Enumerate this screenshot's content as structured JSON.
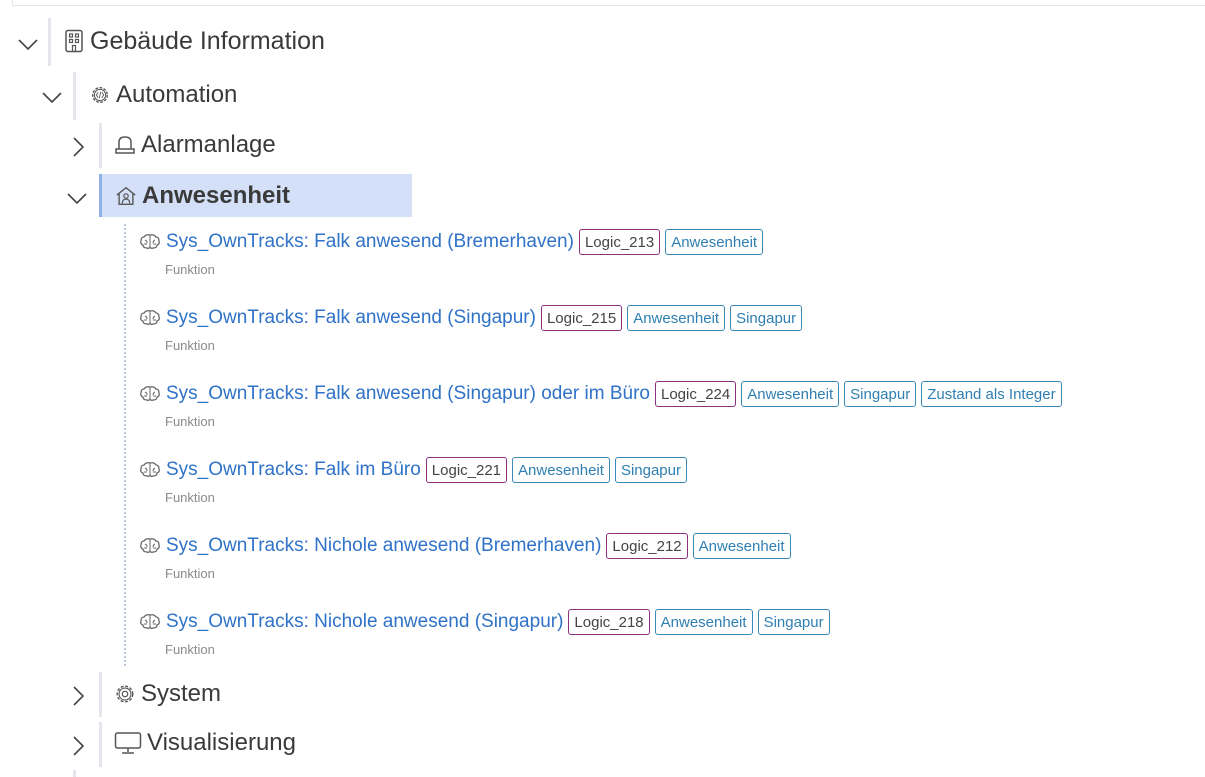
{
  "tree": {
    "root": {
      "label": "Gebäude Information",
      "icon": "building-icon"
    },
    "automation": {
      "label": "Automation",
      "icon": "code-gear-icon"
    },
    "alarm": {
      "label": "Alarmanlage",
      "icon": "alarm-light-icon"
    },
    "anwesenheit": {
      "label": "Anwesenheit",
      "icon": "home-person-icon"
    },
    "system": {
      "label": "System",
      "icon": "gear-icon"
    },
    "visualisierung": {
      "label": "Visualisierung",
      "icon": "monitor-icon"
    }
  },
  "items": [
    {
      "title": "Sys_OwnTracks: Falk anwesend (Bremerhaven)",
      "logic": "Logic_213",
      "tags": [
        "Anwesenheit"
      ],
      "subtitle": "Funktion",
      "icon": "brain-icon"
    },
    {
      "title": "Sys_OwnTracks: Falk anwesend (Singapur)",
      "logic": "Logic_215",
      "tags": [
        "Anwesenheit",
        "Singapur"
      ],
      "subtitle": "Funktion",
      "icon": "brain-icon"
    },
    {
      "title": "Sys_OwnTracks: Falk anwesend (Singapur) oder im Büro",
      "logic": "Logic_224",
      "tags": [
        "Anwesenheit",
        "Singapur",
        "Zustand als Integer"
      ],
      "subtitle": "Funktion",
      "icon": "brain-icon"
    },
    {
      "title": "Sys_OwnTracks: Falk im Büro",
      "logic": "Logic_221",
      "tags": [
        "Anwesenheit",
        "Singapur"
      ],
      "subtitle": "Funktion",
      "icon": "brain-icon"
    },
    {
      "title": "Sys_OwnTracks: Nichole anwesend (Bremerhaven)",
      "logic": "Logic_212",
      "tags": [
        "Anwesenheit"
      ],
      "subtitle": "Funktion",
      "icon": "brain-icon"
    },
    {
      "title": "Sys_OwnTracks: Nichole anwesend (Singapur)",
      "logic": "Logic_218",
      "tags": [
        "Anwesenheit",
        "Singapur"
      ],
      "subtitle": "Funktion",
      "icon": "brain-icon"
    }
  ],
  "colors": {
    "link": "#2f72c8",
    "tag_border": "#3a8ab7",
    "logic_border": "#8e2f82",
    "selected_bg": "#d4e0f7"
  }
}
